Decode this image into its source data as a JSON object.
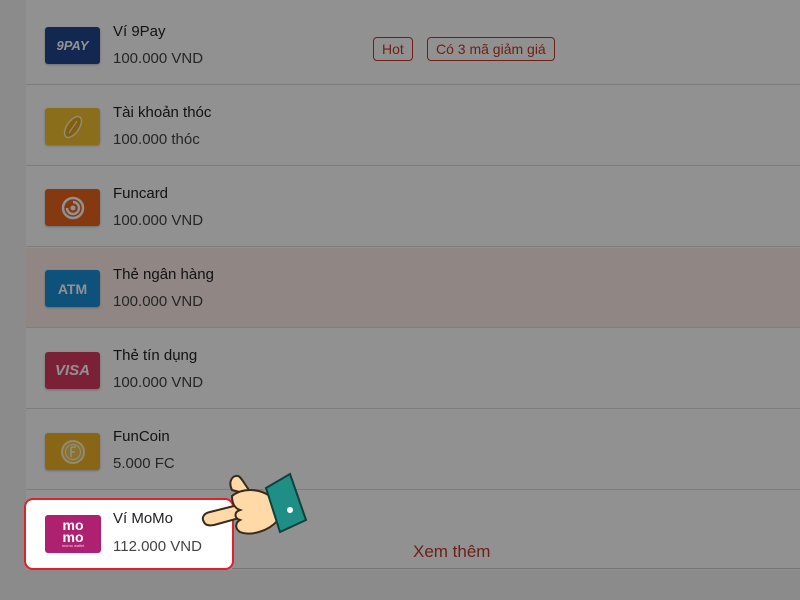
{
  "colors": {
    "accent": "#c0392b",
    "selected_row_bg": "#fdeee9",
    "highlight_border": "#e0202a",
    "momo_brand": "#ae2070"
  },
  "methods": [
    {
      "name": "Ví 9Pay",
      "amount": "100.000 VND",
      "logo_text": "9PAY",
      "logo_color": "#21478f",
      "icon": "9pay-logo-icon"
    },
    {
      "name": "Tài khoản thóc",
      "amount": "100.000 thóc",
      "logo_text": "",
      "logo_color": "#f2c230",
      "icon": "rice-grain-icon"
    },
    {
      "name": "Funcard",
      "amount": "100.000 VND",
      "logo_text": "",
      "logo_color": "#e8641e",
      "icon": "funcard-swirl-icon"
    },
    {
      "name": "Thẻ ngân hàng",
      "amount": "100.000 VND",
      "logo_text": "ATM",
      "logo_color": "#1a8fd8",
      "icon": "atm-card-icon"
    },
    {
      "name": "Thẻ tín dụng",
      "amount": "100.000 VND",
      "logo_text": "VISA",
      "logo_color": "#d93a62",
      "icon": "visa-card-icon"
    },
    {
      "name": "FunCoin",
      "amount": "5.000 FC",
      "logo_text": "",
      "logo_color": "#f0b428",
      "icon": "funcoin-icon"
    }
  ],
  "tags": {
    "hot": "Hot",
    "coupons": "Có 3 mã giảm giá"
  },
  "momo": {
    "name": "Ví MoMo",
    "amount": "112.000 VND",
    "logo_line1": "mo",
    "logo_line2": "mo",
    "logo_sub": "momo wallet"
  },
  "see_more": "Xem thêm",
  "pointer_icon": "pointing-hand-icon"
}
